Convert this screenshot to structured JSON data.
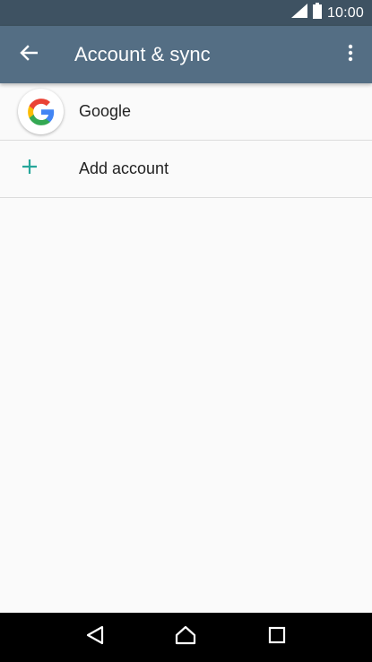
{
  "status_bar": {
    "time": "10:00",
    "icons": [
      "signal-icon",
      "battery-icon"
    ]
  },
  "app_bar": {
    "title": "Account & sync",
    "back_icon": "arrow-back-icon",
    "menu_icon": "more-vert-icon"
  },
  "accounts": [
    {
      "label": "Google",
      "icon": "google-logo-icon"
    },
    {
      "label": "Add account",
      "icon": "plus-icon"
    }
  ],
  "colors": {
    "status_bar": "#3e5262",
    "app_bar": "#546e84",
    "accent": "#26a69a",
    "background": "#fafafa"
  },
  "nav_bar": {
    "icons": [
      "back-triangle-icon",
      "home-icon",
      "recents-icon"
    ]
  }
}
